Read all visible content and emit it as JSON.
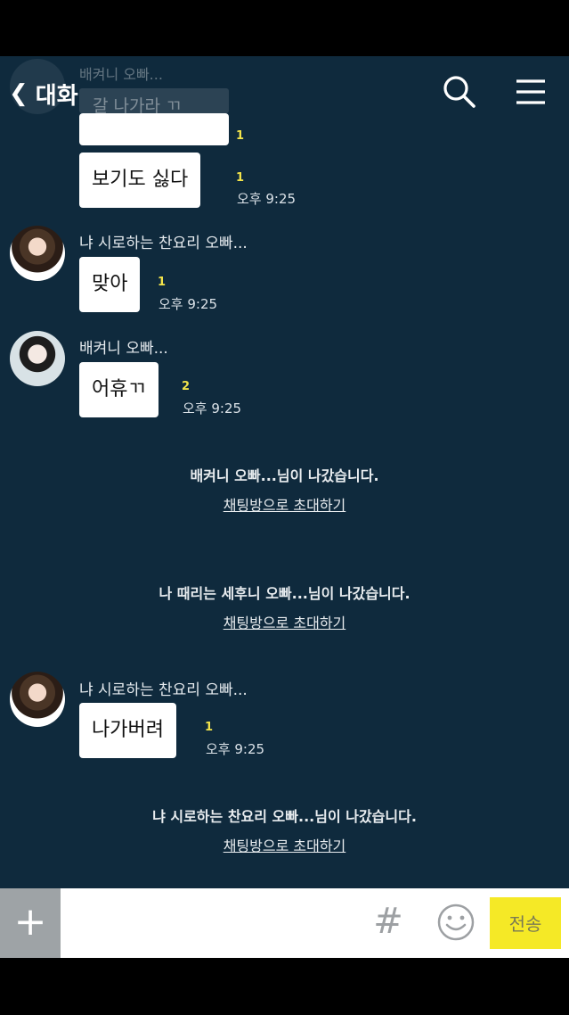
{
  "header": {
    "back_label": "대화",
    "icons": {
      "back": "chevron-left-icon",
      "search": "search-icon",
      "menu": "hamburger-menu-icon"
    }
  },
  "faded_top": {
    "sender": "배켜니 오빠...",
    "text": "갈 나가라 ㄲ"
  },
  "messages": [
    {
      "sender": "",
      "text": "",
      "unread": "1",
      "time": ""
    },
    {
      "sender": "",
      "text": "보기도 싫다",
      "unread": "1",
      "time": "오후 9:25"
    },
    {
      "sender": "냐 시로하는 찬요리 오빠...",
      "text": "맞아",
      "unread": "1",
      "time": "오후 9:25"
    },
    {
      "sender": "배켜니 오빠...",
      "text": "어휴ㄲ",
      "unread": "2",
      "time": "오후 9:25"
    },
    {
      "sender": "냐 시로하는 찬요리 오빠...",
      "text": "나가버려",
      "unread": "1",
      "time": "오후 9:25"
    }
  ],
  "system": [
    {
      "text": "배켜니 오빠...님이 나갔습니다.",
      "link": "채팅방으로 초대하기"
    },
    {
      "text": "나 때리는 세후니 오빠...님이 나갔습니다.",
      "link": "채팅방으로 초대하기"
    },
    {
      "text": "냐 시로하는 찬요리 오빠...님이 나갔습니다.",
      "link": "채팅방으로 초대하기"
    }
  ],
  "input": {
    "plus": "+",
    "placeholder": "",
    "hash": "#",
    "send_label": "전송",
    "icons": {
      "emoji": "smiley-icon"
    }
  },
  "colors": {
    "chat_bg": "#0f2a3d",
    "send_bg": "#f5e926",
    "unread": "#f3e44a"
  }
}
